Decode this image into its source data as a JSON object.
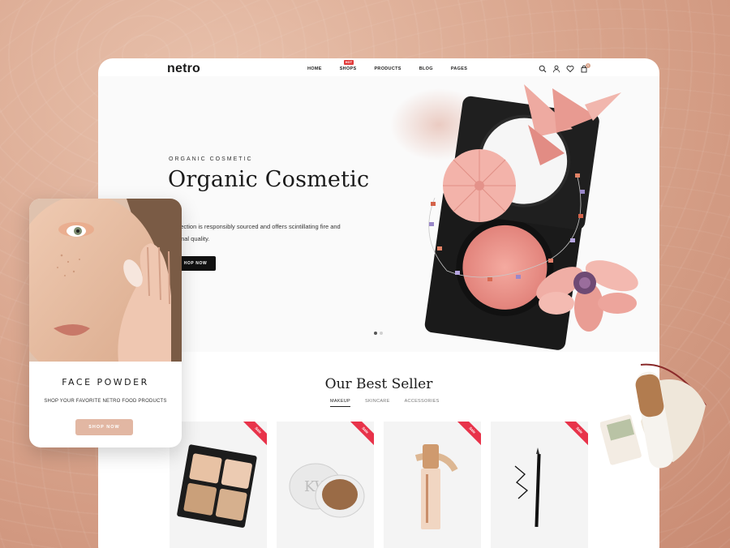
{
  "brand": {
    "logo_text": "netro"
  },
  "nav": {
    "items": [
      {
        "label": "HOME"
      },
      {
        "label": "SHOPS",
        "badge": "HOT"
      },
      {
        "label": "PRODUCTS"
      },
      {
        "label": "BLOG"
      },
      {
        "label": "PAGES"
      }
    ],
    "cart_count": "0"
  },
  "hero": {
    "kicker": "ORGANIC COSMETIC",
    "title": "Organic Cosmetic",
    "description_line1": "collection is responsibly sourced and offers scintillating fire and",
    "description_line2": "ptional quality.",
    "button_label": "HOP NOW"
  },
  "best_seller": {
    "title": "Our Best Seller",
    "tabs": [
      {
        "label": "MAKEUP",
        "active": true
      },
      {
        "label": "SKINCARE",
        "active": false
      },
      {
        "label": "ACCESSORIES",
        "active": false
      }
    ],
    "products": [
      {
        "badge": "Sale",
        "image": "eyeshadow-palette"
      },
      {
        "badge": "Sale",
        "image": "compact-powder"
      },
      {
        "badge": "Sale",
        "image": "foundation-stick"
      },
      {
        "badge": "Sale",
        "image": "eyeliner-pencil"
      }
    ]
  },
  "mobile_card": {
    "title": "FACE POWDER",
    "subtitle": "SHOP YOUR FAVORITE NETRO FOOD PRODUCTS",
    "button_label": "SHOP NOW"
  },
  "colors": {
    "background": "#d9a58d",
    "accent": "#e2b7a3",
    "sale": "#e8334a",
    "hot": "#e23a3a"
  }
}
